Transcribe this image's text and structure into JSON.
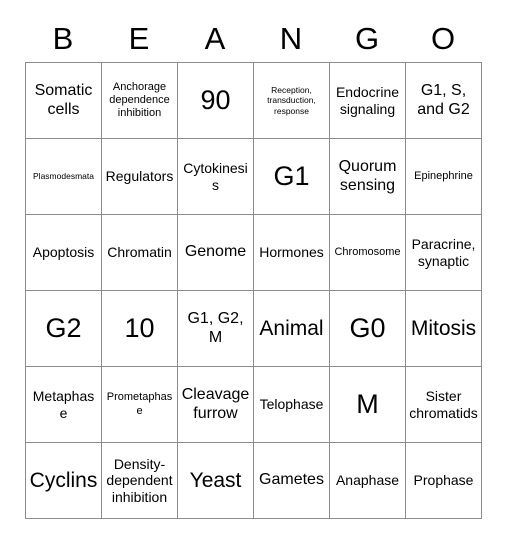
{
  "card": {
    "title_letters": [
      "B",
      "E",
      "A",
      "N",
      "G",
      "O"
    ],
    "grid_size": "6x6",
    "border_color": "#8c8c8c",
    "background_color": "#ffffff",
    "text_color": "#000000",
    "rows": [
      [
        {
          "text": "Somatic cells",
          "size": "lg"
        },
        {
          "text": "Anchorage dependence inhibition",
          "size": "sm"
        },
        {
          "text": "90",
          "size": "xxl"
        },
        {
          "text": "Reception, transduction, response",
          "size": "xs"
        },
        {
          "text": "Endocrine signaling",
          "size": "md"
        },
        {
          "text": "G1, S, and G2",
          "size": "lg"
        }
      ],
      [
        {
          "text": "Plasmodesmata",
          "size": "xs"
        },
        {
          "text": "Regulators",
          "size": "md"
        },
        {
          "text": "Cytokinesis",
          "size": "md"
        },
        {
          "text": "G1",
          "size": "xxl"
        },
        {
          "text": "Quorum sensing",
          "size": "lg"
        },
        {
          "text": "Epinephrine",
          "size": "sm"
        }
      ],
      [
        {
          "text": "Apoptosis",
          "size": "md"
        },
        {
          "text": "Chromatin",
          "size": "md"
        },
        {
          "text": "Genome",
          "size": "lg"
        },
        {
          "text": "Hormones",
          "size": "md"
        },
        {
          "text": "Chromosome",
          "size": "sm"
        },
        {
          "text": "Paracrine, synaptic",
          "size": "md"
        }
      ],
      [
        {
          "text": "G2",
          "size": "xxl"
        },
        {
          "text": "10",
          "size": "xxl"
        },
        {
          "text": "G1, G2, M",
          "size": "lg"
        },
        {
          "text": "Animal",
          "size": "xl"
        },
        {
          "text": "G0",
          "size": "xxl"
        },
        {
          "text": "Mitosis",
          "size": "xl"
        }
      ],
      [
        {
          "text": "Metaphase",
          "size": "md"
        },
        {
          "text": "Prometaphase",
          "size": "sm"
        },
        {
          "text": "Cleavage furrow",
          "size": "lg"
        },
        {
          "text": "Telophase",
          "size": "md"
        },
        {
          "text": "M",
          "size": "xxl"
        },
        {
          "text": "Sister chromatids",
          "size": "md"
        }
      ],
      [
        {
          "text": "Cyclins",
          "size": "xl"
        },
        {
          "text": "Density-dependent inhibition",
          "size": "md"
        },
        {
          "text": "Yeast",
          "size": "xl"
        },
        {
          "text": "Gametes",
          "size": "lg"
        },
        {
          "text": "Anaphase",
          "size": "md"
        },
        {
          "text": "Prophase",
          "size": "md"
        }
      ]
    ]
  }
}
